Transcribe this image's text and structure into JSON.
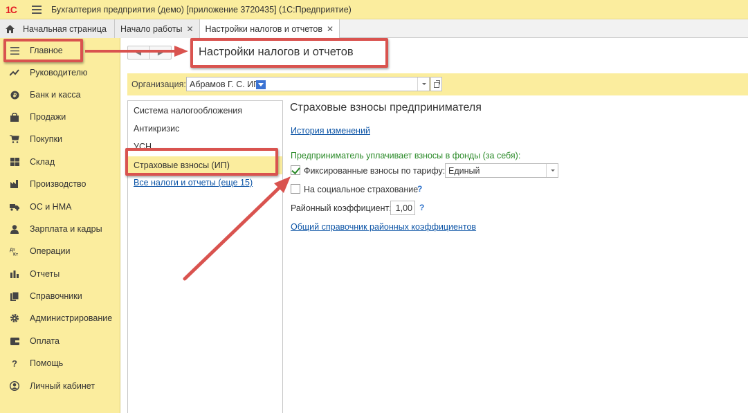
{
  "app": {
    "logo_text": "1С",
    "title": "Бухгалтерия предприятия (демо) [приложение 3720435]  (1С:Предприятие)"
  },
  "tabs": [
    {
      "label": "Начальная страница"
    },
    {
      "label": "Начало работы"
    },
    {
      "label": "Настройки налогов и отчетов"
    }
  ],
  "sidebar": {
    "items": [
      {
        "label": "Главное",
        "icon": "menu-lines-icon"
      },
      {
        "label": "Руководителю",
        "icon": "trend-icon"
      },
      {
        "label": "Банк и касса",
        "icon": "coin-icon"
      },
      {
        "label": "Продажи",
        "icon": "bag-icon"
      },
      {
        "label": "Покупки",
        "icon": "cart-icon"
      },
      {
        "label": "Склад",
        "icon": "grid-icon"
      },
      {
        "label": "Производство",
        "icon": "factory-icon"
      },
      {
        "label": "ОС и НМА",
        "icon": "truck-icon"
      },
      {
        "label": "Зарплата и кадры",
        "icon": "person-icon"
      },
      {
        "label": "Операции",
        "icon": "dt-kt-icon"
      },
      {
        "label": "Отчеты",
        "icon": "bar-chart-icon"
      },
      {
        "label": "Справочники",
        "icon": "books-icon"
      },
      {
        "label": "Администрирование",
        "icon": "gear-icon"
      },
      {
        "label": "Оплата",
        "icon": "wallet-icon"
      },
      {
        "label": "Помощь",
        "icon": "question-icon"
      },
      {
        "label": "Личный кабинет",
        "icon": "user-circle-icon"
      }
    ]
  },
  "form": {
    "title": "Настройки налогов и отчетов",
    "org_label": "Организация:",
    "org_value": "Абрамов Г. С. ИП"
  },
  "left_list": {
    "items": [
      "Система налогообложения",
      "Антикризис",
      "УСН",
      "Страховые взносы (ИП)"
    ],
    "more_link": "Все налоги и отчеты (еще 15)"
  },
  "section": {
    "title": "Страховые взносы предпринимателя",
    "history_link": "История изменений",
    "group_title": "Предприниматель уплачивает взносы в фонды (за себя):",
    "fixed_label": "Фиксированные взносы по тарифу:",
    "fixed_checked": true,
    "tariff_value": "Единый",
    "social_label": "На социальное страхование",
    "social_checked": false,
    "help_mark": "?",
    "coef_label": "Районный коэффициент:",
    "coef_value": "1,00",
    "coef_link": "Общий справочник районных коэффициентов"
  },
  "colors": {
    "panel_yellow": "#fbed9e",
    "link_blue": "#0c54a6",
    "group_green": "#2a8a28",
    "annotation_red": "#d9534f"
  }
}
